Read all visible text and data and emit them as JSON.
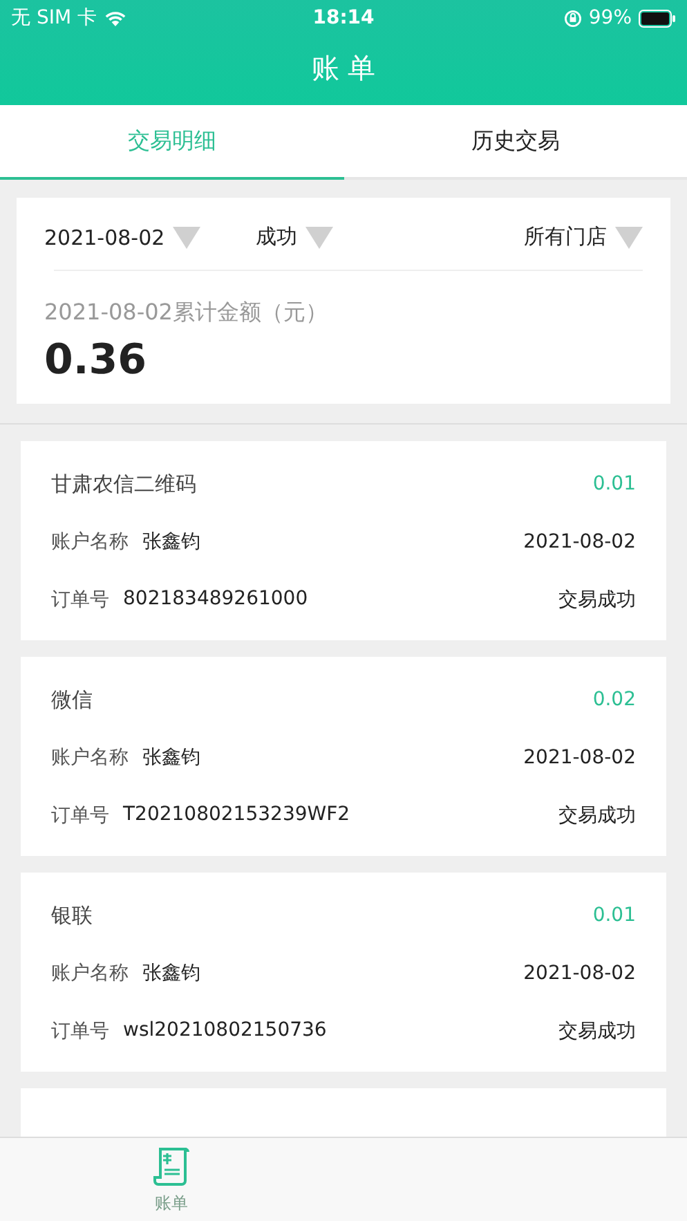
{
  "status_bar": {
    "carrier": "无 SIM 卡",
    "time": "18:14",
    "battery": "99%"
  },
  "title": "账 单",
  "tabs": [
    {
      "label": "交易明细",
      "selected": true
    },
    {
      "label": "历史交易",
      "selected": false
    }
  ],
  "filters": [
    {
      "label": "2021-08-02",
      "kind": "date"
    },
    {
      "label": "成功",
      "kind": "status"
    },
    {
      "label": "所有门店",
      "kind": "store"
    }
  ],
  "summary": {
    "label": "2021-08-02累计金额（元）",
    "amount": "0.36"
  },
  "transactions": [
    {
      "channel": "甘肃农信二维码",
      "amount": "0.01",
      "account_label": "账户名称",
      "account_name": "张鑫钧",
      "date": "2021-08-02",
      "order_label": "订单号",
      "order_no": "802183489261000",
      "status": "交易成功"
    },
    {
      "channel": "微信",
      "amount": "0.02",
      "account_label": "账户名称",
      "account_name": "张鑫钧",
      "date": "2021-08-02",
      "order_label": "订单号",
      "order_no": "T20210802153239WF2",
      "status": "交易成功"
    },
    {
      "channel": "银联",
      "amount": "0.01",
      "account_label": "账户名称",
      "account_name": "张鑫钧",
      "date": "2021-08-02",
      "order_label": "订单号",
      "order_no": "wsl20210802150736",
      "status": "交易成功"
    }
  ],
  "bottom_nav": [
    {
      "label": "账单",
      "selected": true
    }
  ]
}
